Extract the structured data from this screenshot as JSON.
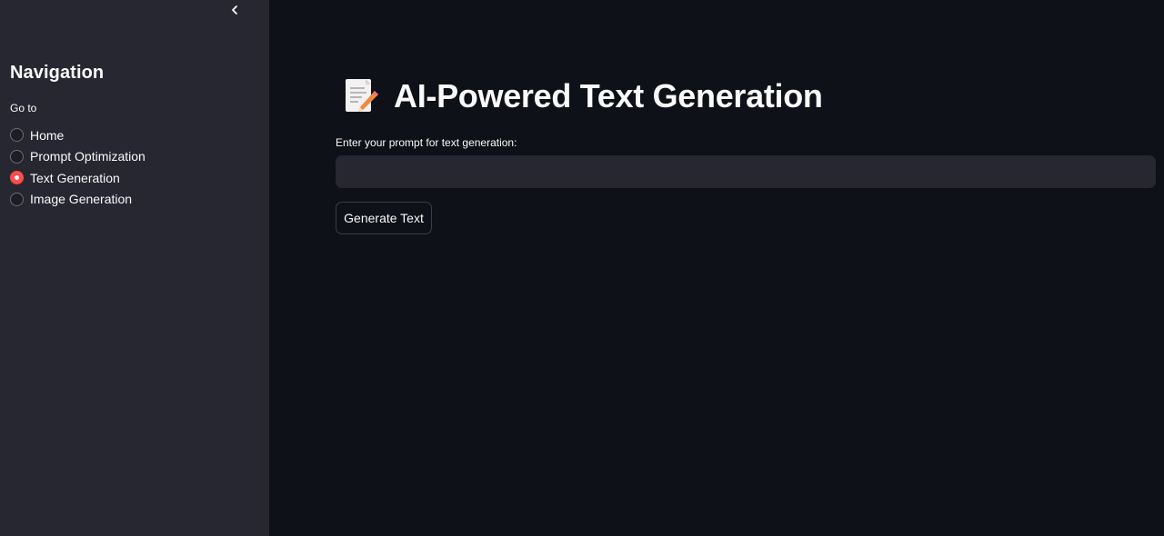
{
  "sidebar": {
    "collapse_icon": "chevron-left-icon",
    "title": "Navigation",
    "radio_label": "Go to",
    "options": [
      {
        "label": "Home",
        "selected": false
      },
      {
        "label": "Prompt Optimization",
        "selected": false
      },
      {
        "label": "Text Generation",
        "selected": true
      },
      {
        "label": "Image Generation",
        "selected": false
      }
    ]
  },
  "main": {
    "title_icon": "memo-icon",
    "title": "AI-Powered Text Generation",
    "input": {
      "label": "Enter your prompt for text generation:",
      "value": "",
      "placeholder": ""
    },
    "generate_button_label": "Generate Text"
  },
  "colors": {
    "background": "#0e1117",
    "sidebar": "#262730",
    "accent": "#ff4b4b",
    "text": "#fafafa"
  }
}
